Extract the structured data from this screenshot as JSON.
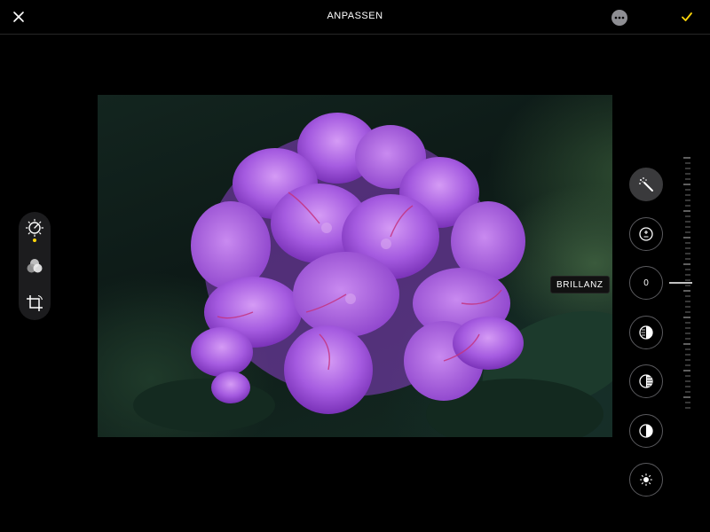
{
  "header": {
    "title": "ANPASSEN",
    "close_icon": "close-icon",
    "more_icon": "more-icon",
    "done_icon": "checkmark-icon",
    "accent_color": "#ffd60a"
  },
  "left_tools": [
    {
      "id": "adjust",
      "icon": "adjust-dial-icon",
      "active": true
    },
    {
      "id": "filters",
      "icon": "filters-icon",
      "active": false
    },
    {
      "id": "crop",
      "icon": "crop-rotate-icon",
      "active": false
    }
  ],
  "adjustments": [
    {
      "id": "auto",
      "icon": "magic-wand-icon",
      "active": true
    },
    {
      "id": "exposure",
      "icon": "exposure-icon",
      "active": false
    },
    {
      "id": "brilliance",
      "label": "BRILLANZ",
      "value": "0",
      "selected": true
    },
    {
      "id": "highlights",
      "icon": "highlights-icon",
      "active": false
    },
    {
      "id": "shadows",
      "icon": "shadows-icon",
      "active": false
    },
    {
      "id": "contrast",
      "icon": "contrast-icon",
      "active": false
    },
    {
      "id": "brightness",
      "icon": "brightness-icon",
      "active": false
    }
  ]
}
